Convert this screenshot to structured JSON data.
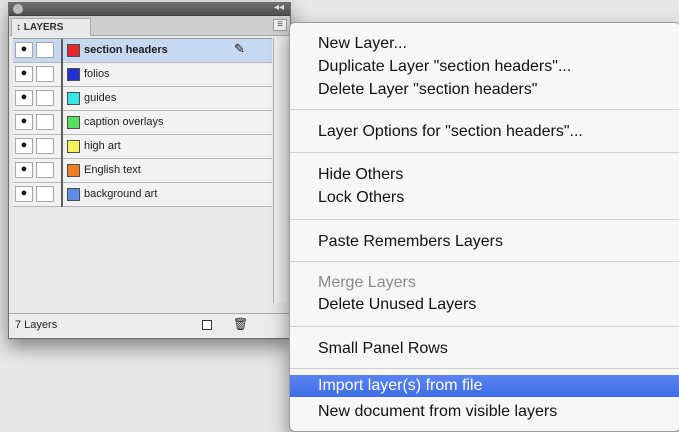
{
  "panel": {
    "tab_label": "LAYERS",
    "tab_icon": "↕",
    "menu_icon": "≡",
    "collapse_icon": "◂◂",
    "layers": [
      {
        "name": "section headers",
        "color": "#e1282d",
        "visible": true,
        "selected": true
      },
      {
        "name": "folios",
        "color": "#2230d6",
        "visible": true,
        "selected": false
      },
      {
        "name": "guides",
        "color": "#37e6e6",
        "visible": true,
        "selected": false
      },
      {
        "name": "caption overlays",
        "color": "#59e05b",
        "visible": true,
        "selected": false
      },
      {
        "name": "high art",
        "color": "#f7f257",
        "visible": true,
        "selected": false
      },
      {
        "name": "English text",
        "color": "#f07c24",
        "visible": true,
        "selected": false
      },
      {
        "name": "background art",
        "color": "#5b8fe7",
        "visible": true,
        "selected": false
      }
    ],
    "status": "7 Layers",
    "selected_icon": "✎"
  },
  "menu": {
    "items": [
      {
        "label": "New Layer...",
        "disabled": false,
        "highlighted": false
      },
      {
        "label": "Duplicate Layer \"section headers\"...",
        "disabled": false,
        "highlighted": false
      },
      {
        "label": "Delete Layer \"section headers\"",
        "disabled": false,
        "highlighted": false
      },
      {
        "label": "Layer Options for \"section headers\"...",
        "disabled": false,
        "highlighted": false
      },
      {
        "label": "Hide Others",
        "disabled": false,
        "highlighted": false
      },
      {
        "label": "Lock Others",
        "disabled": false,
        "highlighted": false
      },
      {
        "label": "Paste Remembers Layers",
        "disabled": false,
        "highlighted": false
      },
      {
        "label": "Merge Layers",
        "disabled": true,
        "highlighted": false
      },
      {
        "label": "Delete Unused Layers",
        "disabled": false,
        "highlighted": false
      },
      {
        "label": "Small Panel Rows",
        "disabled": false,
        "highlighted": false
      },
      {
        "label": "Import layer(s) from file",
        "disabled": false,
        "highlighted": true
      },
      {
        "label": "New document from visible layers",
        "disabled": false,
        "highlighted": false
      }
    ]
  }
}
